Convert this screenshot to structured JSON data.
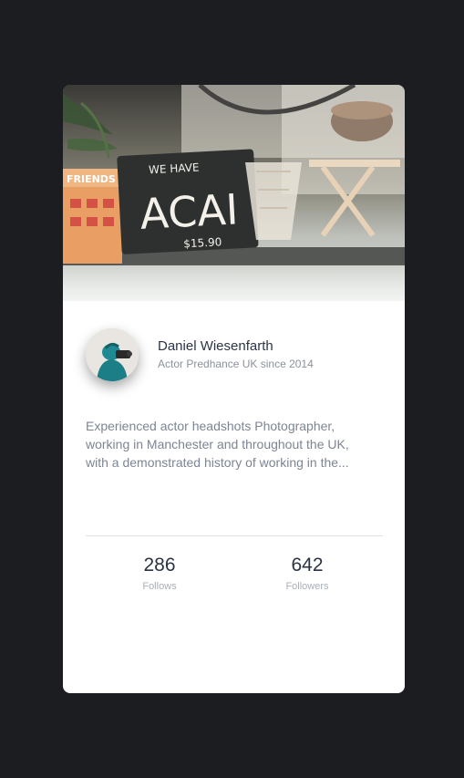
{
  "profile": {
    "name": "Daniel Wiesenfarth",
    "subtitle": "Actor Predhance UK since 2014"
  },
  "bio": {
    "lines": [
      "Experienced actor headshots Photographer,",
      "working in Manchester and throughout the UK,",
      "with a demonstrated history of working in the..."
    ]
  },
  "stats": [
    {
      "value": "286",
      "label": "Follows"
    },
    {
      "value": "642",
      "label": "Followers"
    }
  ],
  "cover": {
    "sign_text": "WE HAVE",
    "sign_main": "ACAI",
    "sign_price": "$15.90",
    "box_text": "FRIENDS"
  },
  "colors": {
    "background": "#1c1d20",
    "card": "#ffffff",
    "name": "#2b3446",
    "muted": "#8a919e"
  }
}
